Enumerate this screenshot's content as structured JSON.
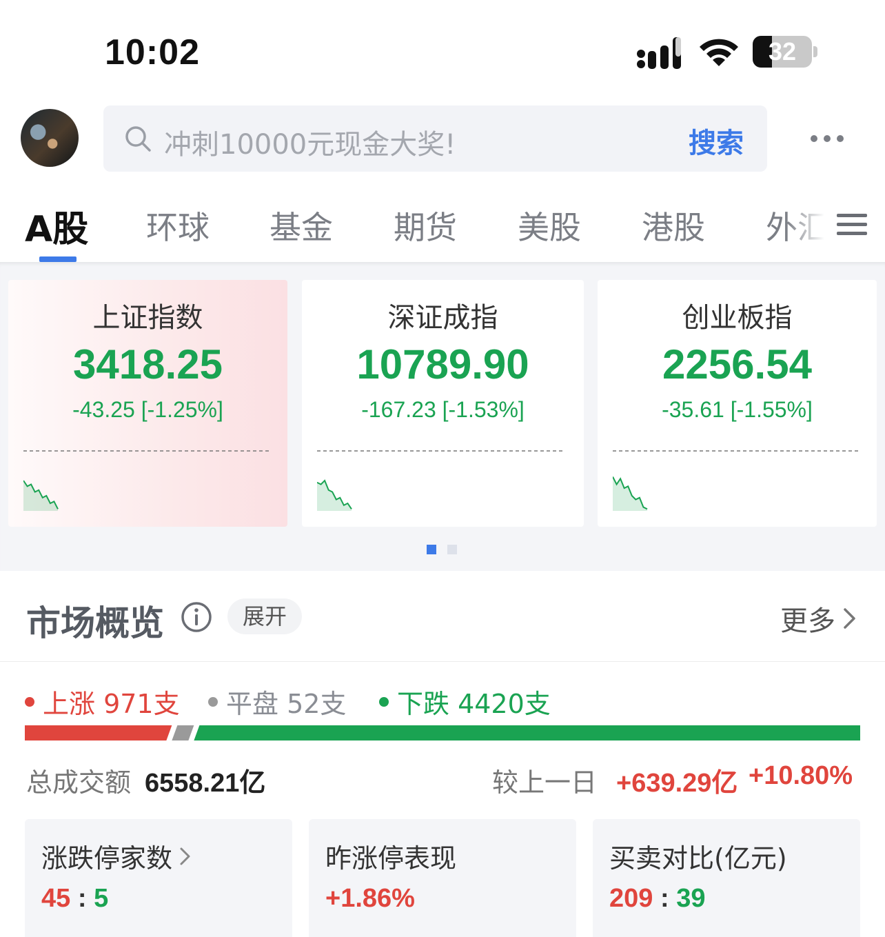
{
  "status_bar": {
    "time": "10:02",
    "battery": "32"
  },
  "search": {
    "placeholder": "冲刺10000元现金大奖!",
    "button_label": "搜索"
  },
  "tabs": [
    {
      "label": "A股",
      "active": true
    },
    {
      "label": "环球",
      "active": false
    },
    {
      "label": "基金",
      "active": false
    },
    {
      "label": "期货",
      "active": false
    },
    {
      "label": "美股",
      "active": false
    },
    {
      "label": "港股",
      "active": false
    },
    {
      "label": "外汇",
      "active": false
    }
  ],
  "indices": [
    {
      "name": "上证指数",
      "value": "3418.25",
      "change": "-43.25 [-1.25%]",
      "spark": [
        0.2,
        0.35,
        0.3,
        0.5,
        0.45,
        0.65,
        0.6,
        0.8,
        0.75,
        0.95
      ]
    },
    {
      "name": "深证成指",
      "value": "10789.90",
      "change": "-167.23 [-1.53%]",
      "spark": [
        0.25,
        0.3,
        0.2,
        0.45,
        0.5,
        0.7,
        0.65,
        0.85,
        0.8,
        0.95
      ]
    },
    {
      "name": "创业板指",
      "value": "2256.54",
      "change": "-35.61 [-1.55%]",
      "spark": [
        0.1,
        0.3,
        0.15,
        0.4,
        0.35,
        0.6,
        0.7,
        0.65,
        0.9,
        0.95
      ]
    }
  ],
  "colors": {
    "up": "#e0453d",
    "down": "#1aa352",
    "flat": "#9a9a9a",
    "accent": "#3d7ae8"
  },
  "overview": {
    "title": "市场概览",
    "expand_label": "展开",
    "more_label": "更多",
    "breadth": {
      "up_label": "上涨 971支",
      "flat_label": "平盘 52支",
      "down_label": "下跌 4420支",
      "up_count": 971,
      "flat_count": 52,
      "down_count": 4420
    },
    "turnover": {
      "label": "总成交额",
      "value": "6558.21亿",
      "compare_label": "较上一日",
      "compare_abs": "+639.29亿",
      "compare_pct": "+10.80%"
    },
    "stats": [
      {
        "title": "涨跌停家数",
        "value_left": "45",
        "sep": ":",
        "value_right": "5"
      },
      {
        "title": "昨涨停表现",
        "value": "+1.86%"
      },
      {
        "title": "买卖对比(亿元)",
        "value_left": "209",
        "sep": ":",
        "value_right": "39"
      }
    ]
  }
}
